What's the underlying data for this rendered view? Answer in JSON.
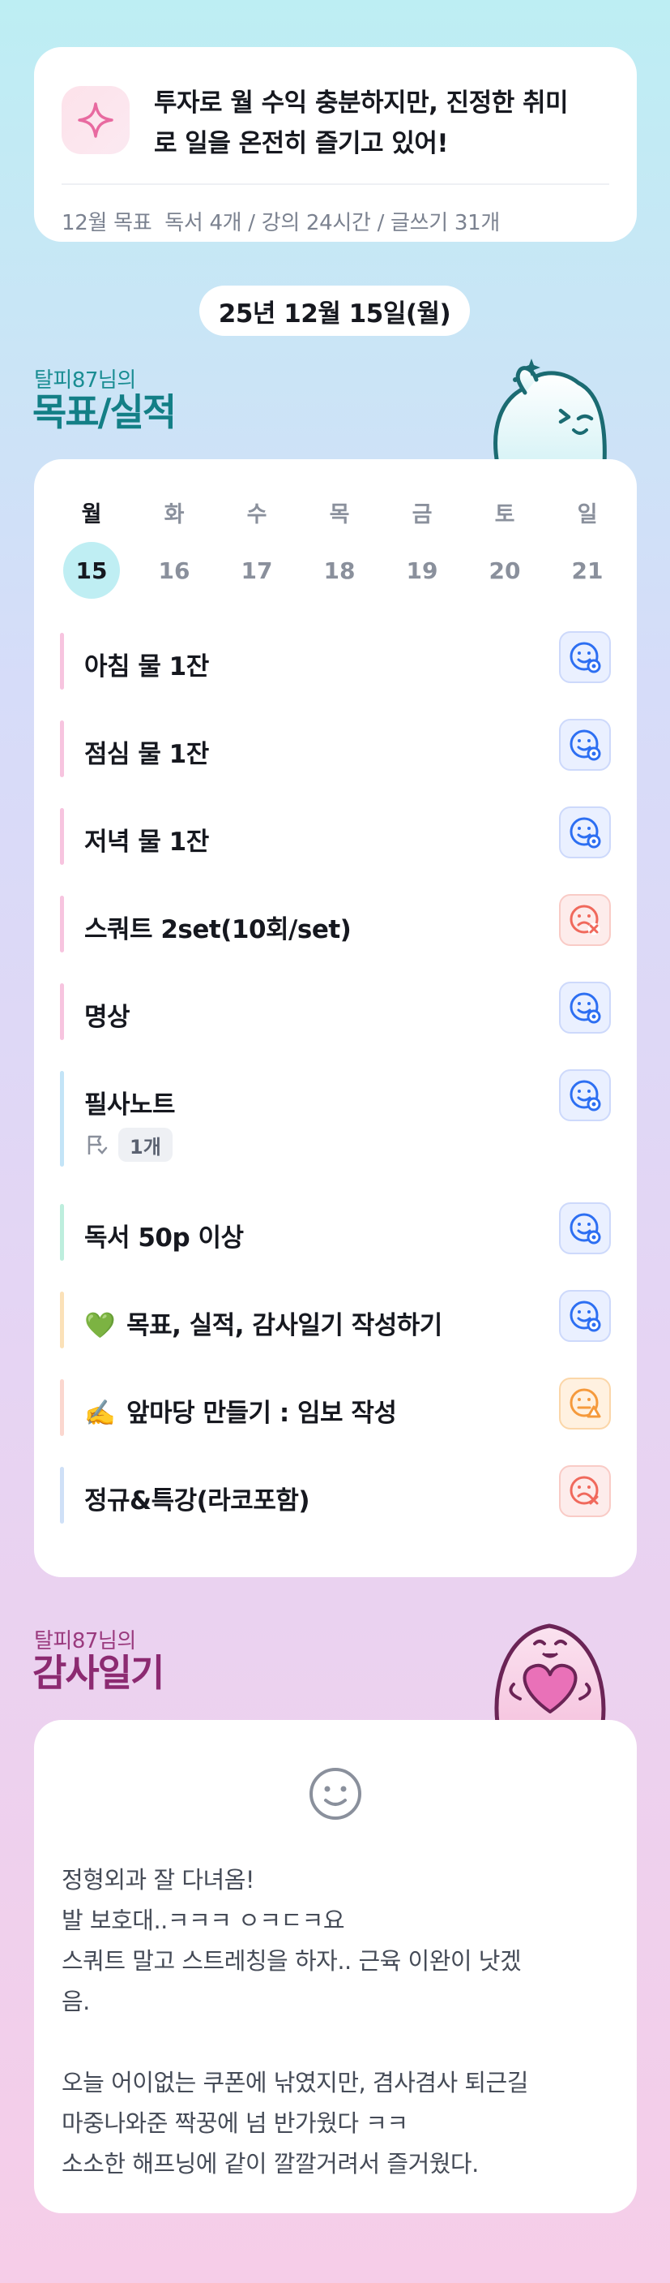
{
  "motto": {
    "icon": "sparkle-icon",
    "text": "투자로 월 수익 충분하지만, 진정한 취미로 일을 온전히 즐기고 있어!",
    "line1": "투자로 월 수익 충분하지만, 진정한 취미",
    "line2": "로 일을 온전히 즐기고 있어!",
    "goal": "12월 목표  독서 4개 / 강의 24시간 / 글쓰기 31개"
  },
  "date_label": "25년 12월 15일(월)",
  "goals_section": {
    "subtitle": "탈피87님의",
    "title": "목표/실적"
  },
  "week": [
    {
      "day": "월",
      "date": "15",
      "active": true
    },
    {
      "day": "화",
      "date": "16",
      "active": false
    },
    {
      "day": "수",
      "date": "17",
      "active": false
    },
    {
      "day": "목",
      "date": "18",
      "active": false
    },
    {
      "day": "금",
      "date": "19",
      "active": false
    },
    {
      "day": "토",
      "date": "20",
      "active": false
    },
    {
      "day": "일",
      "date": "21",
      "active": false
    }
  ],
  "tasks": [
    {
      "title": "아침 물 1잔",
      "status": "done",
      "bar_color": "#f7c4df"
    },
    {
      "title": "점심 물 1잔",
      "status": "done",
      "bar_color": "#f7c4df"
    },
    {
      "title": "저녁 물 1잔",
      "status": "done",
      "bar_color": "#f7c4df"
    },
    {
      "title": "스쿼트 2set(10회/set)",
      "status": "fail",
      "bar_color": "#f7c4df"
    },
    {
      "title": "명상",
      "status": "done",
      "bar_color": "#f7c4df"
    },
    {
      "title": "필사노트",
      "status": "done",
      "bar_color": "#c3e4f7",
      "sub_count": "1개",
      "sub_icon": "flag-icon"
    },
    {
      "title": "독서 50p 이상",
      "status": "done",
      "bar_color": "#bdeedd"
    },
    {
      "title": "목표, 실적, 감사일기 작성하기",
      "emoji": "💚",
      "status": "done",
      "bar_color": "#fbe1b8"
    },
    {
      "title": "앞마당 만들기 : 임보 작성",
      "emoji": "✍️",
      "status": "partial",
      "bar_color": "#fbd7cf"
    },
    {
      "title": "정규&특강(라코포함)",
      "status": "fail",
      "bar_color": "#cfe0f7"
    }
  ],
  "gratitude_section": {
    "subtitle": "탈피87님의",
    "title": "감사일기",
    "mood_icon": "smile-face-icon",
    "lines": [
      "정형외과 잘 다녀옴!",
      "발 보호대..ㅋㅋㅋ ㅇㅋㄷㅋ요",
      "스쿼트 말고 스트레칭을 하자.. 근육 이완이 낫겠",
      "음.",
      "",
      "오늘 어이없는 쿠폰에 낚였지만, 겸사겸사 퇴근길",
      "마중나와준 짝꿍에 넘 반가웠다 ㅋㅋ",
      "소소한 해프닝에 같이 깔깔거려서 즐거웠다."
    ]
  },
  "colors": {
    "done": "#2d6ff2",
    "fail": "#f0695c",
    "partial": "#f59a3c",
    "goals_title": "#137f86",
    "gratitude_title": "#8c2a71"
  }
}
